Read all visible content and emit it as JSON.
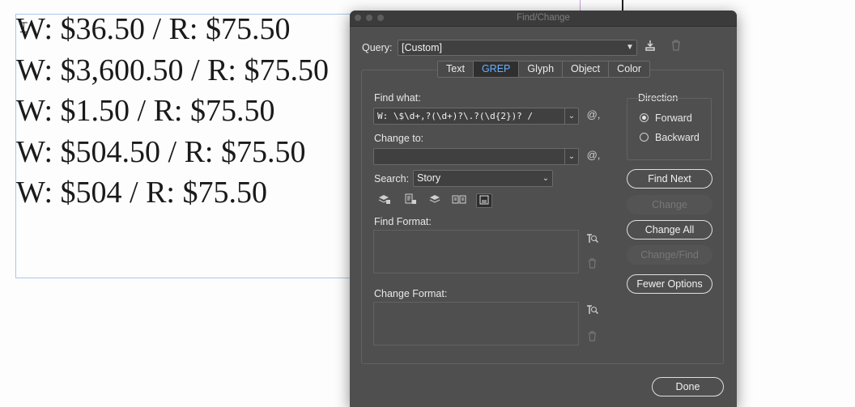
{
  "document": {
    "lines": [
      "W: $36.50 / R: $75.50",
      "W: $3,600.50 / R: $75.50",
      "W: $1.50 / R: $75.50",
      "W: $504.50 / R: $75.50",
      "W: $504 / R: $75.50"
    ]
  },
  "dialog": {
    "title": "Find/Change",
    "query_label": "Query:",
    "query_value": "[Custom]",
    "tabs": [
      {
        "label": "Text",
        "active": false
      },
      {
        "label": "GREP",
        "active": true
      },
      {
        "label": "Glyph",
        "active": false
      },
      {
        "label": "Object",
        "active": false
      },
      {
        "label": "Color",
        "active": false
      }
    ],
    "find_what_label": "Find what:",
    "find_what_value": "W: \\$\\d+,?(\\d+)?\\.?(\\d{2})? /",
    "change_to_label": "Change to:",
    "change_to_value": "",
    "special_char_glyph": "@,",
    "search_label": "Search:",
    "search_value": "Story",
    "find_format_label": "Find Format:",
    "change_format_label": "Change Format:",
    "direction": {
      "label": "Direction",
      "options": [
        {
          "label": "Forward",
          "selected": true
        },
        {
          "label": "Backward",
          "selected": false
        }
      ]
    },
    "buttons": {
      "find_next": "Find Next",
      "change": "Change",
      "change_all": "Change All",
      "change_find": "Change/Find",
      "fewer_options": "Fewer Options",
      "done": "Done"
    }
  },
  "icons": {
    "save_query": "save-query-icon",
    "delete_query": "trash-icon",
    "search_options": [
      "locked-layers-icon",
      "locked-stories-icon",
      "hidden-layers-icon",
      "master-pages-icon",
      "footnotes-icon"
    ]
  }
}
